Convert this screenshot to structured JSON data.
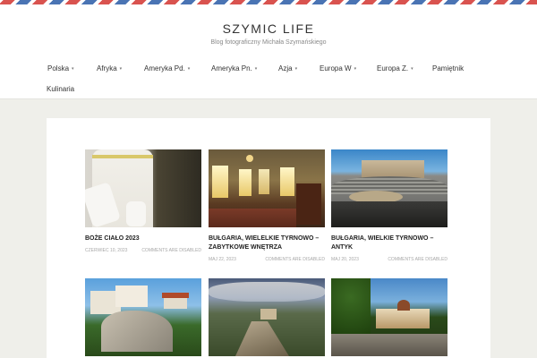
{
  "site": {
    "title": "SZYMIC LIFE",
    "tagline": "Blog fotograficzny Michała Szymańskiego"
  },
  "nav": {
    "caret": "▾",
    "items": [
      {
        "label": "Polska",
        "has_dropdown": true
      },
      {
        "label": "Afryka",
        "has_dropdown": true
      },
      {
        "label": "Ameryka Pd.",
        "has_dropdown": true
      },
      {
        "label": "Ameryka Pn.",
        "has_dropdown": true
      },
      {
        "label": "Azja",
        "has_dropdown": true
      },
      {
        "label": "Europa W",
        "has_dropdown": true
      },
      {
        "label": "Europa Z.",
        "has_dropdown": true
      },
      {
        "label": "Pamiętnik",
        "has_dropdown": false
      },
      {
        "label": "Kulinaria",
        "has_dropdown": false
      }
    ]
  },
  "posts": [
    {
      "title": "Boże Ciało 2023",
      "date": "Czerwiec 10, 2023",
      "comments": "Comments are Disabled",
      "image": "girl-in-white-dress-photo"
    },
    {
      "title": "Bułgaria, Wielelkie Tyrnowo – Zabytkowe wnętrza",
      "date": "Maj 22, 2023",
      "comments": "Comments are Disabled",
      "image": "historic-interior-photo"
    },
    {
      "title": "Bułgaria, Wielkie Tyrnowo – Antyk",
      "date": "Maj 20, 2023",
      "comments": "Comments are Disabled",
      "image": "ancient-amphitheatre-photo"
    },
    {
      "title": "",
      "date": "",
      "comments": "",
      "image": "hilltop-town-photo"
    },
    {
      "title": "",
      "date": "",
      "comments": "",
      "image": "cliff-fortress-photo"
    },
    {
      "title": "",
      "date": "",
      "comments": "",
      "image": "monastery-courtyard-photo"
    }
  ],
  "colors": {
    "background": "#efefea",
    "header": "#ffffff",
    "airmail_red": "#d9534f",
    "airmail_blue": "#4a74b4",
    "text": "#333333",
    "meta": "#a8a8a8"
  }
}
